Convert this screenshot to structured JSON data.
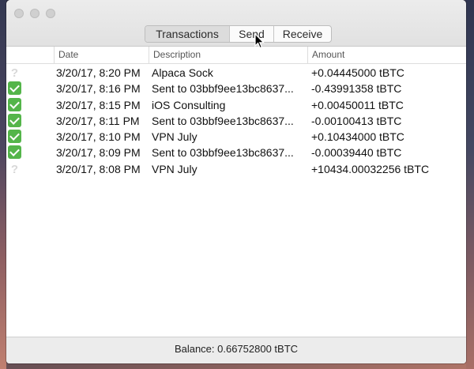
{
  "window": {
    "tabs": [
      {
        "label": "Transactions",
        "selected": true
      },
      {
        "label": "Send",
        "selected": false
      },
      {
        "label": "Receive",
        "selected": false
      }
    ]
  },
  "table": {
    "columns": [
      "",
      "Date",
      "Description",
      "Amount"
    ],
    "rows": [
      {
        "status": "pending-icon",
        "date": "3/20/17, 8:20 PM",
        "description": "Alpaca Sock",
        "amount": "+0.04445000 tBTC"
      },
      {
        "status": "confirmed-icon",
        "date": "3/20/17, 8:16 PM",
        "description": "Sent to 03bbf9ee13bc8637...",
        "amount": "-0.43991358 tBTC"
      },
      {
        "status": "confirmed-icon",
        "date": "3/20/17, 8:15 PM",
        "description": "iOS Consulting",
        "amount": "+0.00450011 tBTC"
      },
      {
        "status": "confirmed-icon",
        "date": "3/20/17, 8:11 PM",
        "description": "Sent to 03bbf9ee13bc8637...",
        "amount": "-0.00100413 tBTC"
      },
      {
        "status": "confirmed-icon",
        "date": "3/20/17, 8:10 PM",
        "description": "VPN July",
        "amount": "+0.10434000 tBTC"
      },
      {
        "status": "confirmed-icon",
        "date": "3/20/17, 8:09 PM",
        "description": "Sent to 03bbf9ee13bc8637...",
        "amount": "-0.00039440 tBTC"
      },
      {
        "status": "pending-icon",
        "date": "3/20/17, 8:08 PM",
        "description": "VPN July",
        "amount": "+10434.00032256 tBTC"
      }
    ]
  },
  "footer": {
    "balance": "Balance: 0.66752800 tBTC"
  },
  "colors": {
    "confirmed": "#54b54a",
    "pending": "#d8d8d8"
  }
}
